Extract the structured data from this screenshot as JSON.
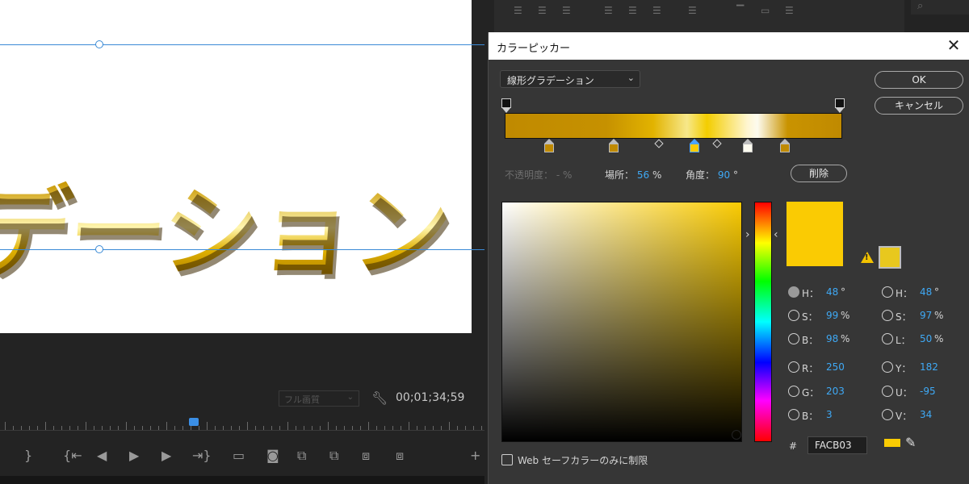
{
  "preview": {
    "title_text": "デーション",
    "resolution_label": "フル画質",
    "timecode": "00;01;34;59"
  },
  "dialog": {
    "title": "カラーピッカー",
    "gradient_type": "線形グラデーション",
    "ok_label": "OK",
    "cancel_label": "キャンセル",
    "opacity_label": "不透明度：",
    "opacity_value": "-",
    "opacity_unit": "%",
    "location_label": "場所：",
    "location_value": "56",
    "location_unit": "%",
    "angle_label": "角度：",
    "angle_value": "90",
    "angle_unit": "°",
    "delete_label": "削除",
    "hsb": {
      "h_label": "H：",
      "h_value": "48",
      "h_unit": "°",
      "s_label": "S：",
      "s_value": "99",
      "s_unit": "%",
      "b_label": "B：",
      "b_value": "98",
      "b_unit": "%"
    },
    "hsl": {
      "h_label": "H：",
      "h_value": "48",
      "h_unit": "°",
      "s_label": "S：",
      "s_value": "97",
      "s_unit": "%",
      "l_label": "L：",
      "l_value": "50",
      "l_unit": "%"
    },
    "rgb": {
      "r_label": "R：",
      "r_value": "250",
      "g_label": "G：",
      "g_value": "203",
      "b_label": "B：",
      "b_value": "3"
    },
    "yuv": {
      "y_label": "Y：",
      "y_value": "182",
      "u_label": "U：",
      "u_value": "-95",
      "v_label": "V：",
      "v_value": "34"
    },
    "hash_label": "#",
    "hex_value": "FACB03",
    "websafe_label": "Web セーフカラーのみに制限",
    "current_color": "#facb03",
    "gradient_stops": [
      {
        "color": "#c08a00"
      },
      {
        "color": "#c08a00"
      },
      {
        "color": "#facb03",
        "selected": true
      },
      {
        "color": "#fdfbef"
      },
      {
        "color": "#c08a00"
      }
    ]
  }
}
